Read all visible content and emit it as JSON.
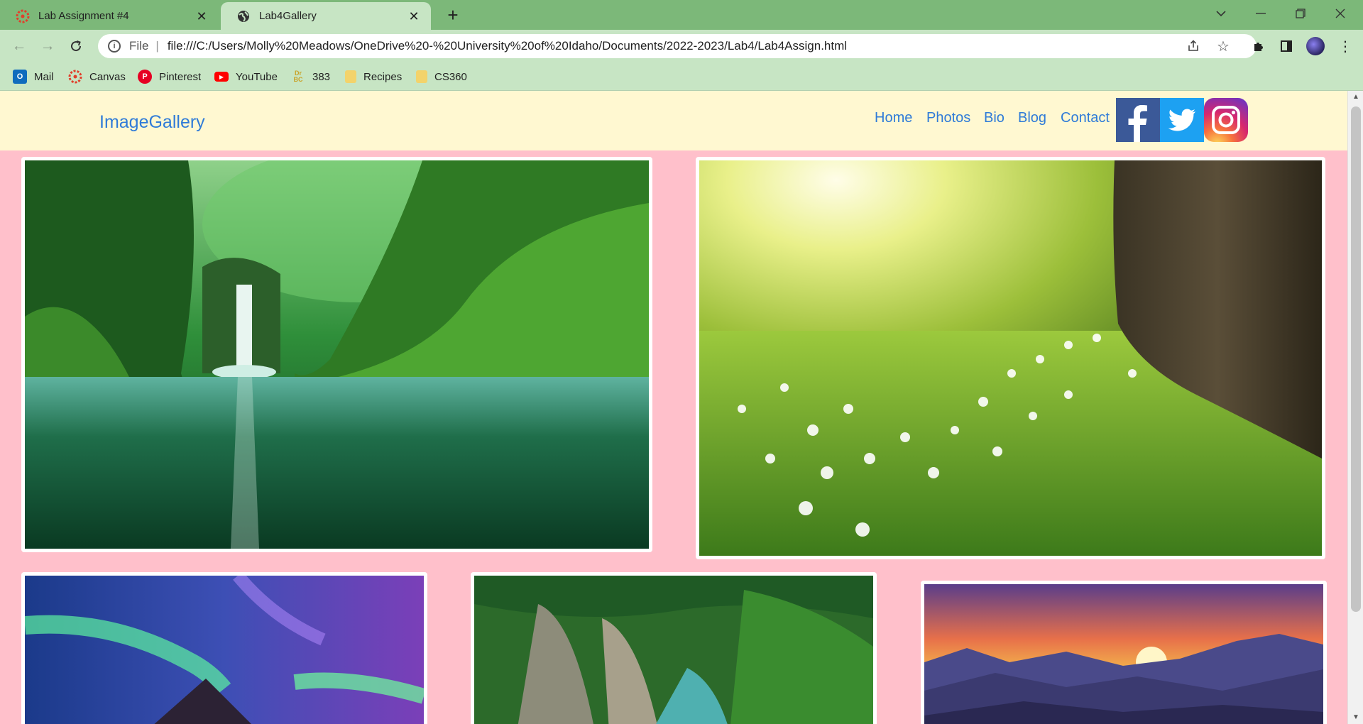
{
  "browser": {
    "tabs": [
      {
        "title": "Lab Assignment #4",
        "active": false,
        "icon": "canvas-icon"
      },
      {
        "title": "Lab4Gallery",
        "active": true,
        "icon": "globe-icon"
      }
    ],
    "new_tab_icon": "plus-icon",
    "window_controls": [
      "chevron-down-icon",
      "minimize-icon",
      "restore-icon",
      "close-icon"
    ],
    "address_bar": {
      "scheme_label": "File",
      "url": "file:///C:/Users/Molly%20Meadows/OneDrive%20-%20University%20of%20Idaho/Documents/2022-2023/Lab4/Lab4Assign.html"
    },
    "bookmarks": [
      {
        "label": "Mail",
        "icon": "outlook-icon",
        "color": "#0f6cbd"
      },
      {
        "label": "Canvas",
        "icon": "canvas-icon",
        "color": "#e13f2b"
      },
      {
        "label": "Pinterest",
        "icon": "pinterest-icon",
        "color": "#e60023"
      },
      {
        "label": "YouTube",
        "icon": "youtube-icon",
        "color": "#ff0000"
      },
      {
        "label": "383",
        "icon": "drbc-icon",
        "color": "#c9a227"
      },
      {
        "label": "Recipes",
        "icon": "folder-icon",
        "color": "#f3d36b"
      },
      {
        "label": "CS360",
        "icon": "folder-icon",
        "color": "#f3d36b"
      }
    ],
    "theme": {
      "frame": "#7cb879",
      "toolbar": "#c7e5c4"
    }
  },
  "site": {
    "brand": "ImageGallery",
    "nav": [
      "Home",
      "Photos",
      "Bio",
      "Blog",
      "Contact"
    ],
    "social": [
      "facebook-icon",
      "twitter-icon",
      "instagram-icon"
    ],
    "colors": {
      "nav_bg": "#fff8d1",
      "link": "#2f7bd8",
      "page_bg": "#ffc0cb"
    }
  },
  "gallery": [
    {
      "subject": "waterfall-canyon"
    },
    {
      "subject": "meadow-tree-sunlight"
    },
    {
      "subject": "aurora-mountain"
    },
    {
      "subject": "forest-river-gorge"
    },
    {
      "subject": "mountain-sunset"
    }
  ]
}
